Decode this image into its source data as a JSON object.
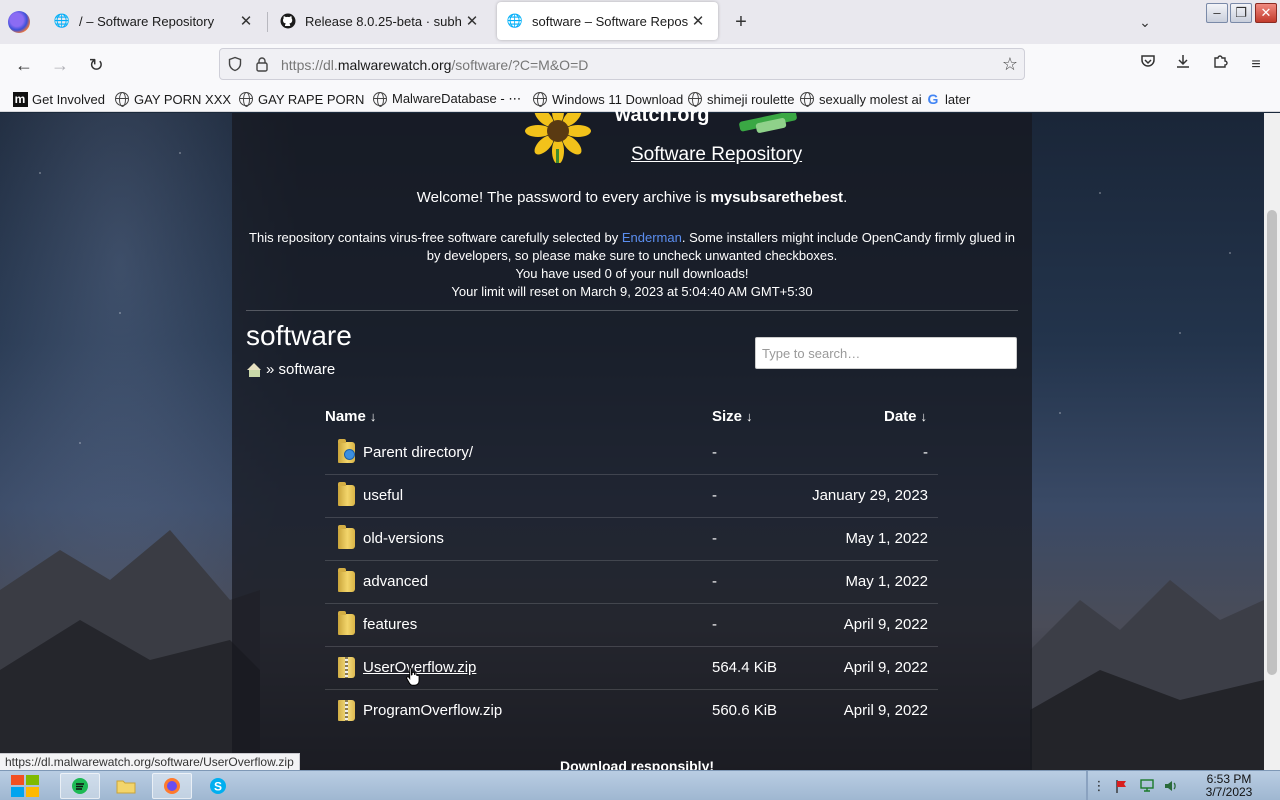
{
  "browser": {
    "tabs": [
      {
        "title": "/ – Software Repository",
        "close": "✕",
        "active": false
      },
      {
        "title": "Release 8.0.25-beta · subh",
        "close": "✕",
        "active": false
      },
      {
        "title": "software – Software Reposito",
        "close": "✕",
        "active": true
      }
    ],
    "new_tab_label": "+",
    "list_all_tabs_label": "⌄",
    "window_controls": {
      "minimize": "–",
      "maximize": "❐",
      "close": "✕"
    },
    "url": {
      "prefix": "https://dl.",
      "domain": "malwarewatch.org",
      "path": "/software/?C=M&O=D"
    },
    "bookmarks": [
      {
        "label": "Get Involved",
        "icon": "m-icon"
      },
      {
        "label": "GAY PORN XXX",
        "icon": "globe-icon"
      },
      {
        "label": "GAY RAPE PORN",
        "icon": "globe-icon"
      },
      {
        "label": "MalwareDatabase - ⋯",
        "icon": "globe-icon"
      },
      {
        "label": "Windows 11 Download",
        "icon": "globe-icon"
      },
      {
        "label": "shimeji roulette",
        "icon": "globe-icon"
      },
      {
        "label": "sexually molest ai",
        "icon": "globe-icon"
      },
      {
        "label": "later",
        "icon": "google-icon"
      }
    ],
    "status_url": "https://dl.malwarewatch.org/software/UserOverflow.zip"
  },
  "page": {
    "logo_text": "watch.org",
    "repo_title": "Software Repository",
    "welcome_prefix": "Welcome! The password to every archive is ",
    "password": "mysubsarethebest",
    "welcome_suffix": ".",
    "info_line1_prefix": "This repository contains virus-free software carefully selected by ",
    "info_link": "Enderman",
    "info_line1_suffix": ". Some installers might include OpenCandy firmly glued in by developers, so please make sure to uncheck unwanted checkboxes.",
    "info_line2": "You have used 0 of your null downloads!",
    "info_line3": "Your limit will reset on March 9, 2023 at 5:04:40 AM GMT+5:30",
    "heading": "software",
    "breadcrumb_sep": "»",
    "breadcrumb_current": "software",
    "search_placeholder": "Type to search…",
    "columns": {
      "name": "Name",
      "size": "Size",
      "date": "Date",
      "sort_arrow": "↓"
    },
    "entries": [
      {
        "name": "Parent directory/",
        "size": "-",
        "date": "-",
        "type": "parent"
      },
      {
        "name": "useful",
        "size": "-",
        "date": "January 29, 2023",
        "type": "folder"
      },
      {
        "name": "old-versions",
        "size": "-",
        "date": "May 1, 2022",
        "type": "folder"
      },
      {
        "name": "advanced",
        "size": "-",
        "date": "May 1, 2022",
        "type": "folder"
      },
      {
        "name": "features",
        "size": "-",
        "date": "April 9, 2022",
        "type": "folder"
      },
      {
        "name": "UserOverflow.zip",
        "size": "564.4 KiB",
        "date": "April 9, 2022",
        "type": "zip",
        "hovered": true
      },
      {
        "name": "ProgramOverflow.zip",
        "size": "560.6 KiB",
        "date": "April 9, 2022",
        "type": "zip"
      }
    ],
    "footer": "Download responsibly!"
  },
  "taskbar": {
    "time": "6:53 PM",
    "date": "3/7/2023"
  },
  "colors": {
    "link": "#5b8ef0",
    "panel": "rgba(22,24,30,0.72)"
  }
}
